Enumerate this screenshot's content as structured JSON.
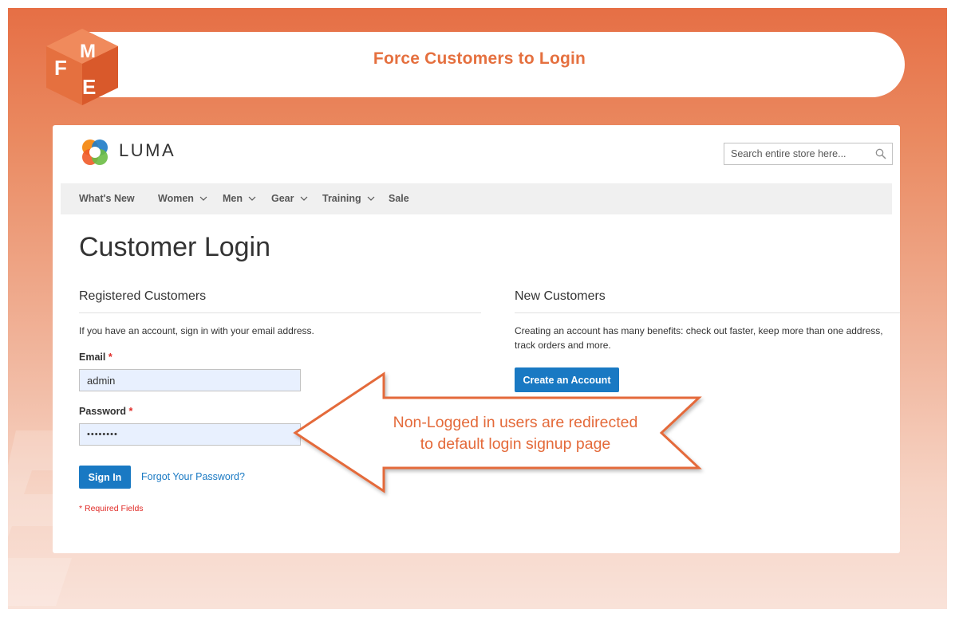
{
  "banner": {
    "title": "Force Customers to Login",
    "logo_letters": [
      "F",
      "M",
      "E"
    ]
  },
  "store": {
    "logo_text": "LUMA",
    "search": {
      "placeholder": "Search entire store here..."
    },
    "nav": [
      {
        "label": "What's New",
        "has_dropdown": false
      },
      {
        "label": "Women",
        "has_dropdown": true
      },
      {
        "label": "Men",
        "has_dropdown": true
      },
      {
        "label": "Gear",
        "has_dropdown": true
      },
      {
        "label": "Training",
        "has_dropdown": true
      },
      {
        "label": "Sale",
        "has_dropdown": false
      }
    ]
  },
  "login": {
    "page_title": "Customer Login",
    "registered": {
      "title": "Registered Customers",
      "note": "If you have an account, sign in with your email address.",
      "email_label": "Email",
      "email_value": "admin",
      "password_label": "Password",
      "password_value": "••••••••",
      "required_marker": "*",
      "sign_in": "Sign In",
      "forgot": "Forgot Your Password?",
      "required_note": "* Required Fields"
    },
    "new_customers": {
      "title": "New Customers",
      "note_line1": "Creating an account has many benefits: check out faster, keep more than one address,",
      "note_line2": "track orders and more.",
      "create_account": "Create an Account"
    }
  },
  "callout": {
    "line1": "Non-Logged in users are redirected",
    "line2": "to default login signup page"
  },
  "colors": {
    "accent_orange": "#e5703f",
    "magento_blue": "#1979c3",
    "required_red": "#e02b27"
  }
}
